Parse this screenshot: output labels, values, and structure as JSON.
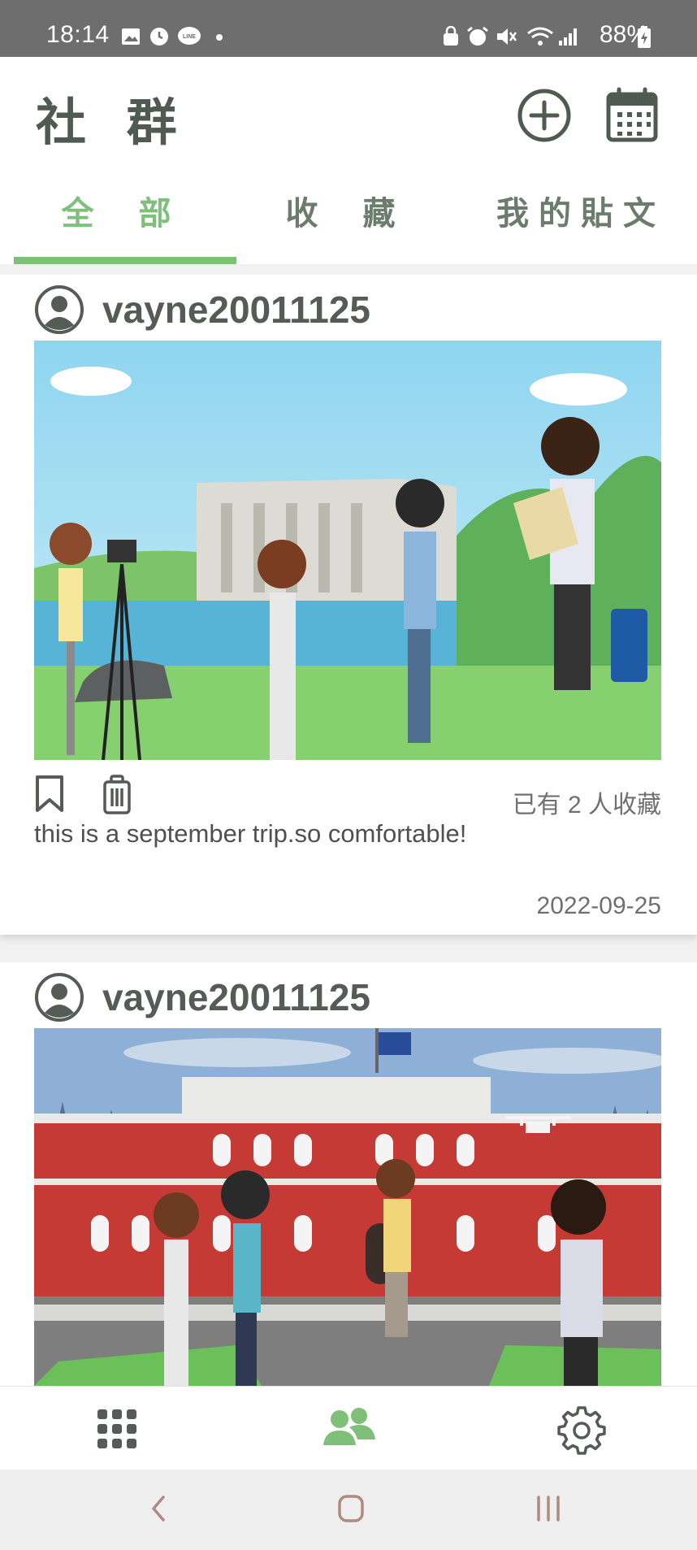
{
  "status_bar": {
    "time": "18:14",
    "battery": "88%",
    "icons": [
      "image-icon",
      "clock-icon",
      "line-app-icon",
      "dot-icon",
      "lock-icon",
      "alarm-icon",
      "mute-icon",
      "wifi-icon",
      "signal-icon",
      "battery-charging-icon"
    ]
  },
  "header": {
    "title": "社 群",
    "add_icon": "plus-circle-icon",
    "calendar_icon": "calendar-icon"
  },
  "tabs": [
    {
      "label": "全 部",
      "active": true
    },
    {
      "label": "收 藏",
      "active": false
    },
    {
      "label": "我的貼文",
      "active": false
    }
  ],
  "posts": [
    {
      "author": "vayne20011125",
      "image": "cartoon-travelers-at-dam-illustration",
      "favorite_count_text": "已有 2 人收藏",
      "caption": "this is a september trip.so comfortable!",
      "date": "2022-09-25"
    },
    {
      "author": "vayne20011125",
      "image": "cartoon-people-at-red-building-illustration"
    }
  ],
  "bottom_nav": {
    "items": [
      "apps-grid-icon",
      "community-icon",
      "settings-gear-icon"
    ],
    "active_index": 1
  },
  "system_nav": [
    "back-icon",
    "home-icon",
    "recents-icon"
  ],
  "colors": {
    "accent": "#7ebf7a",
    "title": "#4f5b50",
    "status_bar": "#6e6e6e"
  }
}
